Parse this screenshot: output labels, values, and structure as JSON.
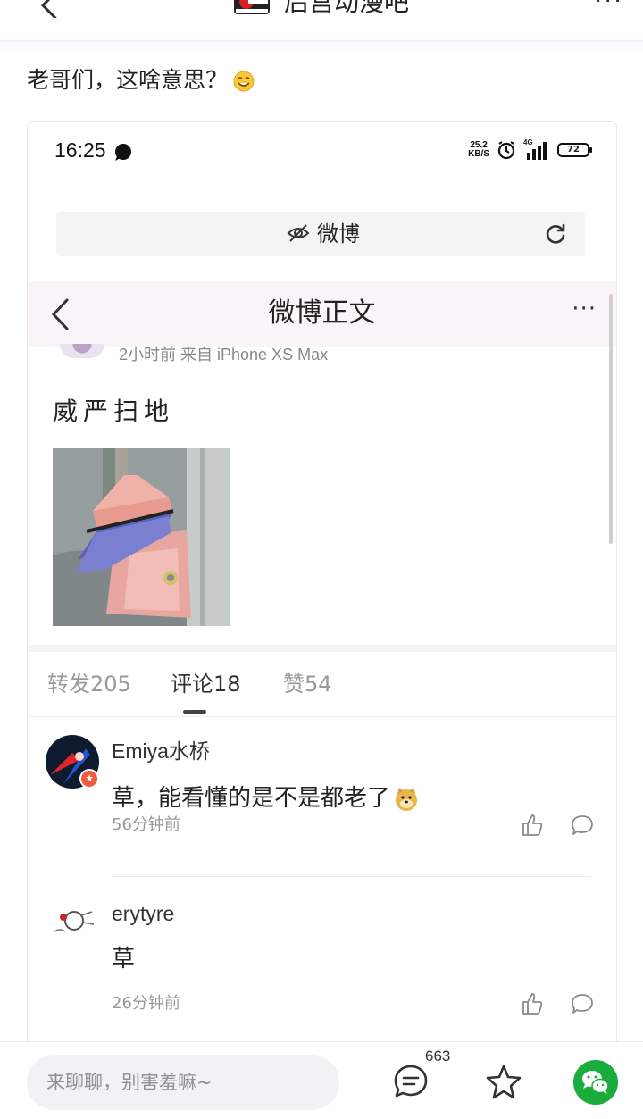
{
  "topbar": {
    "back_icon": "chevron-left-icon",
    "forum_title": "后宫动漫吧",
    "more_icon": "more-dots-icon"
  },
  "post": {
    "title": "老哥们，这啥意思？",
    "title_emoji": "smile-emoji-icon"
  },
  "screenshot": {
    "status": {
      "time": "16:25",
      "speed_value": "25.2",
      "speed_unit": "KB/S",
      "network": "4G",
      "battery": "72"
    },
    "urlbar": {
      "site": "微博"
    },
    "navbar": {
      "title": "微博正文"
    },
    "weibo": {
      "meta": "2小时前 来自 iPhone XS Max",
      "text": "威严扫地"
    },
    "tabs": [
      {
        "label": "转发205",
        "active": false
      },
      {
        "label": "评论18",
        "active": true
      },
      {
        "label": "赞54",
        "active": false
      }
    ],
    "comments": [
      {
        "name": "Emiya水桥",
        "text": "草，能看懂的是不是都老了",
        "time": "56分钟前"
      },
      {
        "name": "erytyre",
        "text": "草",
        "time": "26分钟前"
      }
    ]
  },
  "bottombar": {
    "reply_placeholder": "来聊聊，别害羞嘛~",
    "comment_count": "663"
  },
  "colors": {
    "wechat_green": "#1aad3c",
    "navbar_bg": "#fbf5fa",
    "badge_red": "#f05a3c"
  }
}
